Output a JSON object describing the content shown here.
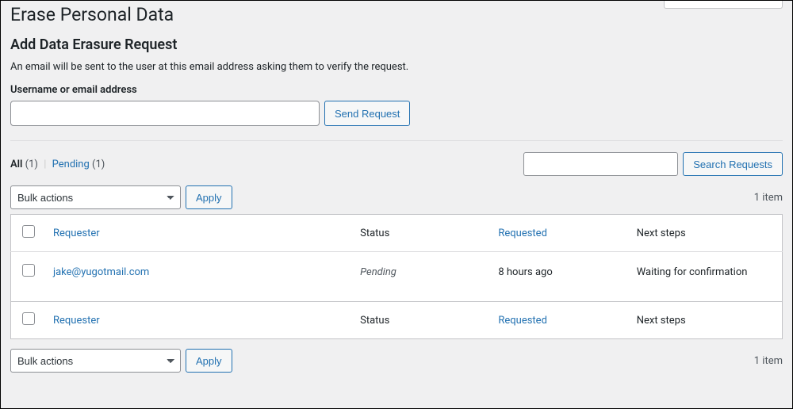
{
  "page_title": "Erase Personal Data",
  "form": {
    "heading": "Add Data Erasure Request",
    "description": "An email will be sent to the user at this email address asking them to verify the request.",
    "field_label": "Username or email address",
    "input_value": "",
    "submit_label": "Send Request"
  },
  "filters": {
    "all_label": "All",
    "all_count": "(1)",
    "separator": "|",
    "pending_label": "Pending",
    "pending_count": "(1)"
  },
  "search": {
    "input_value": "",
    "button_label": "Search Requests"
  },
  "bulk": {
    "placeholder": "Bulk actions",
    "apply_label": "Apply"
  },
  "pagination": {
    "item_count": "1 item"
  },
  "columns": {
    "requester": "Requester",
    "status": "Status",
    "requested": "Requested",
    "next_steps": "Next steps"
  },
  "rows": [
    {
      "requester": "jake@yugotmail.com",
      "status": "Pending",
      "requested": "8 hours ago",
      "next_steps": "Waiting for confirmation"
    }
  ]
}
